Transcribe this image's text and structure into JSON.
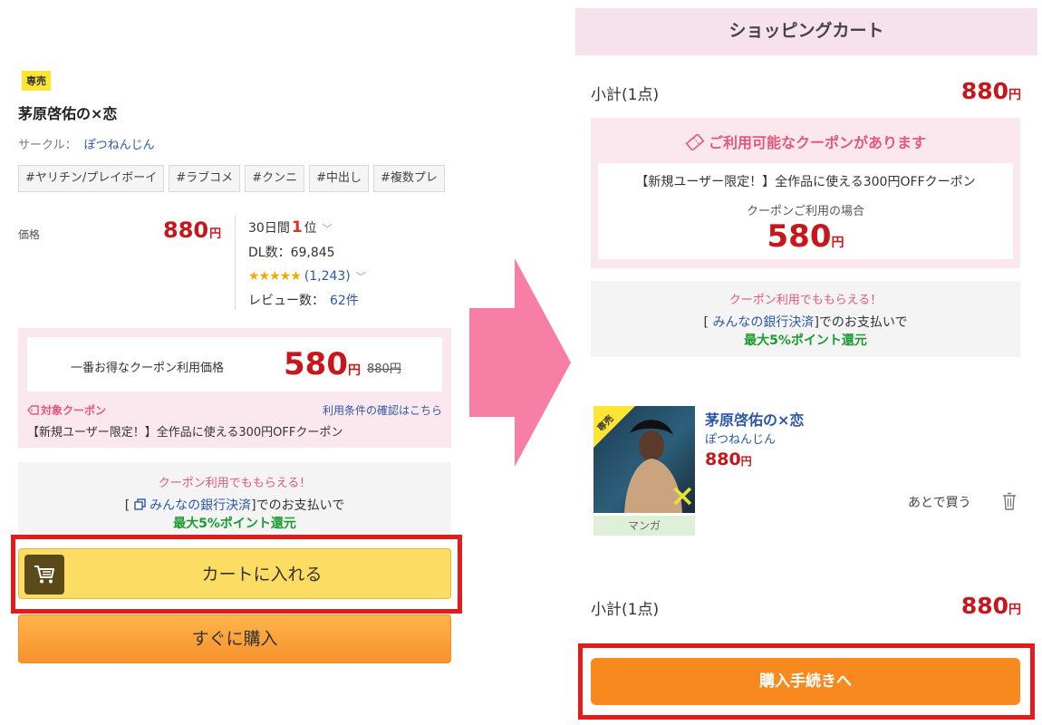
{
  "left": {
    "badge": "専売",
    "title": "茅原啓佑の×恋",
    "circle_label": "サークル：",
    "circle_name": "ぽつねんじん",
    "tags": [
      "#ヤリチン/プレイボーイ",
      "#ラブコメ",
      "#クンニ",
      "#中出し",
      "#複数プレ"
    ],
    "price_label": "価格",
    "price": "880",
    "yen": "円",
    "rank_prefix": "30日間",
    "rank_num": "1",
    "rank_suffix": "位",
    "dl": "DL数：69,845",
    "stars": "★★★★★",
    "rating_count": "(1,243)",
    "review_label": "レビュー数：",
    "review_count": "62件",
    "coupon": {
      "best_label": "一番お得なクーポン利用価格",
      "price": "580",
      "original": "880円",
      "target_label": "対象クーポン",
      "terms_link": "利用条件の確認はこちら",
      "desc": "【新規ユーザー限定！】全作品に使える300円OFFクーポン"
    },
    "bank": {
      "line1": "クーポン利用でももらえる！",
      "bracket_open": "[",
      "bank_name": "みんなの銀行決済",
      "line2_suffix": "]でのお支払いで",
      "line3": "最大5%ポイント還元"
    },
    "cart_button": "カートに入れる",
    "buy_now_button": "すぐに購入"
  },
  "right": {
    "header": "ショッピングカート",
    "subtotal_label": "小計(1点)",
    "subtotal": "880",
    "yen": "円",
    "coupon": {
      "title": "ご利用可能なクーポンがあります",
      "desc": "【新規ユーザー限定！】全作品に使える300円OFFクーポン",
      "use_label": "クーポンご利用の場合",
      "price": "580"
    },
    "bank": {
      "line1": "クーポン利用でももらえる！",
      "bracket_open": "[",
      "bank_name": "みんなの銀行決済",
      "line2_suffix": "]でのお支払いで",
      "line3": "最大5%ポイント還元"
    },
    "item": {
      "badge": "専売",
      "title": "茅原啓佑の×恋",
      "circle": "ぽつねんじん",
      "price": "880",
      "category": "マンガ",
      "save_later": "あとで買う"
    },
    "checkout_button": "購入手続きへ"
  },
  "colors": {
    "price_red": "#c8161d",
    "link_blue": "#2d58a6",
    "coupon_pink_bg": "#fbe8ee",
    "coupon_pink_text": "#e4587a",
    "point_green": "#1c9b2f",
    "cart_yellow": "#fddc63",
    "buy_orange": "#f7891e",
    "highlight_red": "#e31b1b",
    "arrow_pink": "#f77ea4"
  },
  "icons": [
    "cart-icon",
    "coupon-tag-icon",
    "external-window-icon",
    "chevron-down-icon",
    "trash-icon",
    "arrow-right"
  ]
}
